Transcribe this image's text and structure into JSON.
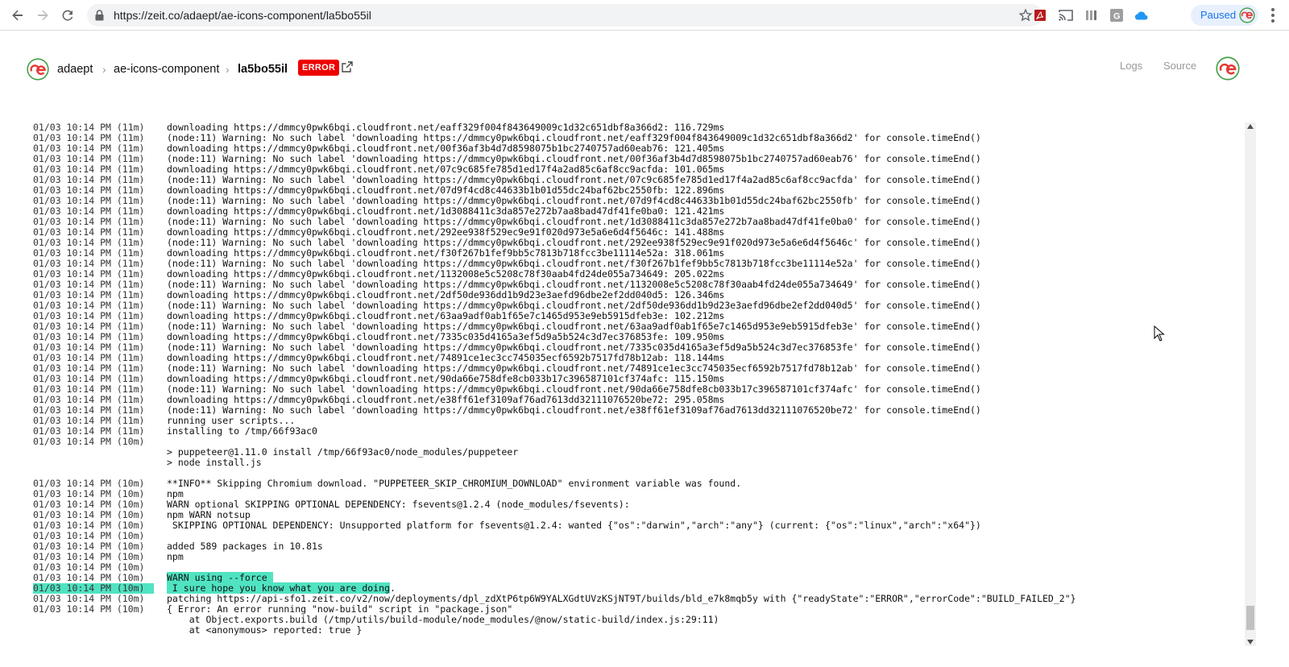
{
  "browser": {
    "url": "https://zeit.co/adaept/ae-icons-component/la5bo55il",
    "profile_label": "Paused",
    "back_icon": "arrow-left-icon",
    "forward_icon": "arrow-right-icon",
    "reload_icon": "reload-icon",
    "bookmark_icon": "star-icon",
    "extensions": [
      "pdf-icon",
      "cast-icon",
      "library-icon",
      "grammarly-icon",
      "cloud-icon"
    ]
  },
  "header": {
    "user": "adaept",
    "project": "ae-icons-component",
    "deployment": "la5bo55il",
    "status_badge": "ERROR",
    "tabs": [
      "Logs",
      "Source"
    ],
    "colors": {
      "logo_red": "#e53935",
      "logo_green": "#43a047",
      "badge": "#ee0000",
      "highlight": "#50e3c2"
    }
  },
  "log": {
    "lines": [
      {
        "ts": "01/03 10:14 PM (11m)",
        "msg": "downloading https://dmmcy0pwk6bqi.cloudfront.net/eaff329f004f843649009c1d32c651dbf8a366d2: 116.729ms"
      },
      {
        "ts": "01/03 10:14 PM (11m)",
        "msg": "(node:11) Warning: No such label 'downloading https://dmmcy0pwk6bqi.cloudfront.net/eaff329f004f843649009c1d32c651dbf8a366d2' for console.timeEnd()"
      },
      {
        "ts": "01/03 10:14 PM (11m)",
        "msg": "downloading https://dmmcy0pwk6bqi.cloudfront.net/00f36af3b4d7d8598075b1bc2740757ad60eab76: 121.405ms"
      },
      {
        "ts": "01/03 10:14 PM (11m)",
        "msg": "(node:11) Warning: No such label 'downloading https://dmmcy0pwk6bqi.cloudfront.net/00f36af3b4d7d8598075b1bc2740757ad60eab76' for console.timeEnd()"
      },
      {
        "ts": "01/03 10:14 PM (11m)",
        "msg": "downloading https://dmmcy0pwk6bqi.cloudfront.net/07c9c685fe785d1ed17f4a2ad85c6af8cc9acfda: 101.065ms"
      },
      {
        "ts": "01/03 10:14 PM (11m)",
        "msg": "(node:11) Warning: No such label 'downloading https://dmmcy0pwk6bqi.cloudfront.net/07c9c685fe785d1ed17f4a2ad85c6af8cc9acfda' for console.timeEnd()"
      },
      {
        "ts": "01/03 10:14 PM (11m)",
        "msg": "downloading https://dmmcy0pwk6bqi.cloudfront.net/07d9f4cd8c44633b1b01d55dc24baf62bc2550fb: 122.896ms"
      },
      {
        "ts": "01/03 10:14 PM (11m)",
        "msg": "(node:11) Warning: No such label 'downloading https://dmmcy0pwk6bqi.cloudfront.net/07d9f4cd8c44633b1b01d55dc24baf62bc2550fb' for console.timeEnd()"
      },
      {
        "ts": "01/03 10:14 PM (11m)",
        "msg": "downloading https://dmmcy0pwk6bqi.cloudfront.net/1d3088411c3da857e272b7aa8bad47df41fe0ba0: 121.421ms"
      },
      {
        "ts": "01/03 10:14 PM (11m)",
        "msg": "(node:11) Warning: No such label 'downloading https://dmmcy0pwk6bqi.cloudfront.net/1d3088411c3da857e272b7aa8bad47df41fe0ba0' for console.timeEnd()"
      },
      {
        "ts": "01/03 10:14 PM (11m)",
        "msg": "downloading https://dmmcy0pwk6bqi.cloudfront.net/292ee938f529ec9e91f020d973e5a6e6d4f5646c: 141.488ms"
      },
      {
        "ts": "01/03 10:14 PM (11m)",
        "msg": "(node:11) Warning: No such label 'downloading https://dmmcy0pwk6bqi.cloudfront.net/292ee938f529ec9e91f020d973e5a6e6d4f5646c' for console.timeEnd()"
      },
      {
        "ts": "01/03 10:14 PM (11m)",
        "msg": "downloading https://dmmcy0pwk6bqi.cloudfront.net/f30f267b1fef9bb5c7813b718fcc3be11114e52a: 318.061ms"
      },
      {
        "ts": "01/03 10:14 PM (11m)",
        "msg": "(node:11) Warning: No such label 'downloading https://dmmcy0pwk6bqi.cloudfront.net/f30f267b1fef9bb5c7813b718fcc3be11114e52a' for console.timeEnd()"
      },
      {
        "ts": "01/03 10:14 PM (11m)",
        "msg": "downloading https://dmmcy0pwk6bqi.cloudfront.net/1132008e5c5208c78f30aab4fd24de055a734649: 205.022ms"
      },
      {
        "ts": "01/03 10:14 PM (11m)",
        "msg": "(node:11) Warning: No such label 'downloading https://dmmcy0pwk6bqi.cloudfront.net/1132008e5c5208c78f30aab4fd24de055a734649' for console.timeEnd()"
      },
      {
        "ts": "01/03 10:14 PM (11m)",
        "msg": "downloading https://dmmcy0pwk6bqi.cloudfront.net/2df50de936dd1b9d23e3aefd96dbe2ef2dd040d5: 126.346ms"
      },
      {
        "ts": "01/03 10:14 PM (11m)",
        "msg": "(node:11) Warning: No such label 'downloading https://dmmcy0pwk6bqi.cloudfront.net/2df50de936dd1b9d23e3aefd96dbe2ef2dd040d5' for console.timeEnd()"
      },
      {
        "ts": "01/03 10:14 PM (11m)",
        "msg": "downloading https://dmmcy0pwk6bqi.cloudfront.net/63aa9adf0ab1f65e7c1465d953e9eb5915dfeb3e: 102.212ms"
      },
      {
        "ts": "01/03 10:14 PM (11m)",
        "msg": "(node:11) Warning: No such label 'downloading https://dmmcy0pwk6bqi.cloudfront.net/63aa9adf0ab1f65e7c1465d953e9eb5915dfeb3e' for console.timeEnd()"
      },
      {
        "ts": "01/03 10:14 PM (11m)",
        "msg": "downloading https://dmmcy0pwk6bqi.cloudfront.net/7335c035d4165a3ef5d9a5b524c3d7ec376853fe: 109.950ms"
      },
      {
        "ts": "01/03 10:14 PM (11m)",
        "msg": "(node:11) Warning: No such label 'downloading https://dmmcy0pwk6bqi.cloudfront.net/7335c035d4165a3ef5d9a5b524c3d7ec376853fe' for console.timeEnd()"
      },
      {
        "ts": "01/03 10:14 PM (11m)",
        "msg": "downloading https://dmmcy0pwk6bqi.cloudfront.net/74891ce1ec3cc745035ecf6592b7517fd78b12ab: 118.144ms"
      },
      {
        "ts": "01/03 10:14 PM (11m)",
        "msg": "(node:11) Warning: No such label 'downloading https://dmmcy0pwk6bqi.cloudfront.net/74891ce1ec3cc745035ecf6592b7517fd78b12ab' for console.timeEnd()"
      },
      {
        "ts": "01/03 10:14 PM (11m)",
        "msg": "downloading https://dmmcy0pwk6bqi.cloudfront.net/90da66e758dfe8cb033b17c396587101cf374afc: 115.150ms"
      },
      {
        "ts": "01/03 10:14 PM (11m)",
        "msg": "(node:11) Warning: No such label 'downloading https://dmmcy0pwk6bqi.cloudfront.net/90da66e758dfe8cb033b17c396587101cf374afc' for console.timeEnd()"
      },
      {
        "ts": "01/03 10:14 PM (11m)",
        "msg": "downloading https://dmmcy0pwk6bqi.cloudfront.net/e38ff61ef3109af76ad7613dd32111076520be72: 295.058ms"
      },
      {
        "ts": "01/03 10:14 PM (11m)",
        "msg": "(node:11) Warning: No such label 'downloading https://dmmcy0pwk6bqi.cloudfront.net/e38ff61ef3109af76ad7613dd32111076520be72' for console.timeEnd()"
      },
      {
        "ts": "01/03 10:14 PM (11m)",
        "msg": "running user scripts..."
      },
      {
        "ts": "01/03 10:14 PM (11m)",
        "msg": "installing to /tmp/66f93ac0"
      },
      {
        "ts": "01/03 10:14 PM (10m)",
        "msg": ""
      },
      {
        "ts": "",
        "msg": "> puppeteer@1.11.0 install /tmp/66f93ac0/node_modules/puppeteer"
      },
      {
        "ts": "",
        "msg": "> node install.js"
      },
      {
        "ts": "",
        "msg": ""
      },
      {
        "ts": "01/03 10:14 PM (10m)",
        "msg": "**INFO** Skipping Chromium download. \"PUPPETEER_SKIP_CHROMIUM_DOWNLOAD\" environment variable was found."
      },
      {
        "ts": "01/03 10:14 PM (10m)",
        "msg": "npm"
      },
      {
        "ts": "01/03 10:14 PM (10m)",
        "msg": "WARN optional SKIPPING OPTIONAL DEPENDENCY: fsevents@1.2.4 (node_modules/fsevents):"
      },
      {
        "ts": "01/03 10:14 PM (10m)",
        "msg": "npm WARN notsup"
      },
      {
        "ts": "01/03 10:14 PM (10m)",
        "msg": " SKIPPING OPTIONAL DEPENDENCY: Unsupported platform for fsevents@1.2.4: wanted {\"os\":\"darwin\",\"arch\":\"any\"} (current: {\"os\":\"linux\",\"arch\":\"x64\"})"
      },
      {
        "ts": "01/03 10:14 PM (10m)",
        "msg": ""
      },
      {
        "ts": "01/03 10:14 PM (10m)",
        "msg": "added 589 packages in 10.81s"
      },
      {
        "ts": "01/03 10:14 PM (10m)",
        "msg": "npm"
      },
      {
        "ts": "01/03 10:14 PM (10m)",
        "msg": ""
      },
      {
        "ts": "01/03 10:14 PM (10m)",
        "msg": "WARN using --force ",
        "hl": true
      },
      {
        "ts": "01/03 10:14 PM (10m)",
        "msg": " I sure hope you know what you are doing",
        "hl": true,
        "suffix": ".",
        "active": true
      },
      {
        "ts": "01/03 10:14 PM (10m)",
        "msg": "patching https://api-sfo1.zeit.co/v2/now/deployments/dpl_zdXtP6tp6W9YALXGdtUVzKSjNT9T/builds/bld_e7k8mqb5y with {\"readyState\":\"ERROR\",\"errorCode\":\"BUILD_FAILED_2\"}"
      },
      {
        "ts": "01/03 10:14 PM (10m)",
        "msg": "{ Error: An error running \"now-build\" script in \"package.json\""
      },
      {
        "ts": "",
        "msg": "    at Object.exports.build (/tmp/utils/build-module/node_modules/@now/static-build/index.js:29:11)"
      },
      {
        "ts": "",
        "msg": "    at <anonymous> reported: true }"
      }
    ]
  }
}
